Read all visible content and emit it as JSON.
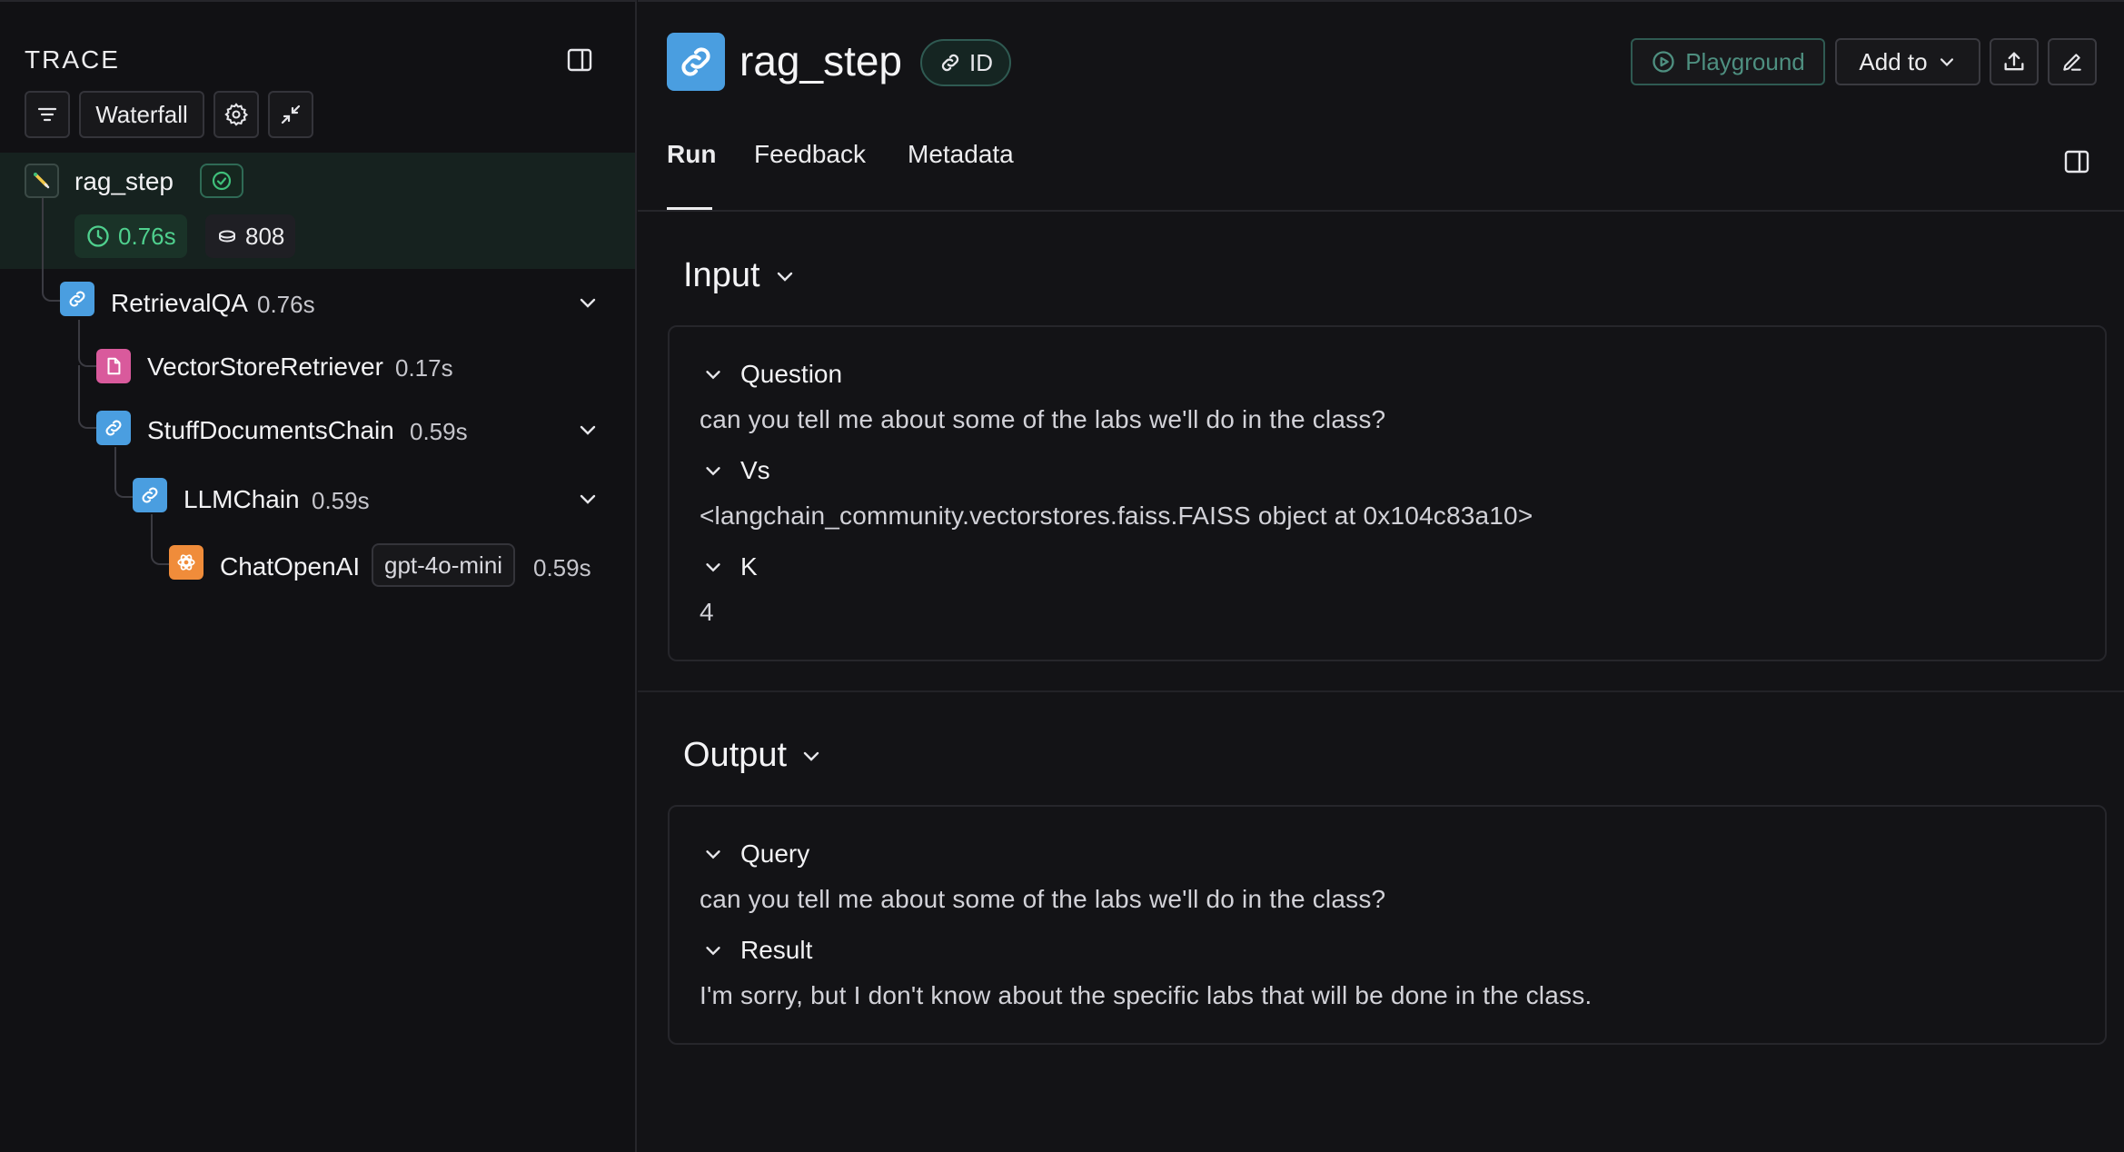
{
  "trace": {
    "title": "TRACE",
    "toolbar": {
      "waterfall_label": "Waterfall"
    },
    "root": {
      "label": "rag_step",
      "latency": "0.76s",
      "tokens": "808",
      "status": "success"
    },
    "nodes": [
      {
        "label": "RetrievalQA",
        "time": "0.76s",
        "icon": "link-icon"
      },
      {
        "label": "VectorStoreRetriever",
        "time": "0.17s",
        "icon": "document-icon"
      },
      {
        "label": "StuffDocumentsChain",
        "time": "0.59s",
        "icon": "link-icon"
      },
      {
        "label": "LLMChain",
        "time": "0.59s",
        "icon": "link-icon"
      },
      {
        "label": "ChatOpenAI",
        "model": "gpt-4o-mini",
        "time": "0.59s",
        "icon": "openai-icon"
      }
    ]
  },
  "header": {
    "title": "rag_step",
    "id_label": "ID",
    "playground_label": "Playground",
    "add_to_label": "Add to"
  },
  "tabs": [
    {
      "label": "Run",
      "active": true
    },
    {
      "label": "Feedback",
      "active": false
    },
    {
      "label": "Metadata",
      "active": false
    }
  ],
  "input": {
    "title": "Input",
    "fields": [
      {
        "key": "Question",
        "value": "can you tell me about some of the labs we'll do in the class?"
      },
      {
        "key": "Vs",
        "value": "<langchain_community.vectorstores.faiss.FAISS object at 0x104c83a10>"
      },
      {
        "key": "K",
        "value": "4"
      }
    ]
  },
  "output": {
    "title": "Output",
    "fields": [
      {
        "key": "Query",
        "value": "can you tell me about some of the labs we'll do in the class?"
      },
      {
        "key": "Result",
        "value": "I'm sorry, but I don't know about the specific labs that will be done in the class."
      }
    ]
  },
  "colors": {
    "chain_icon": "#4a9ee0",
    "retriever_icon": "#d95a9c",
    "llm_icon": "#f08c3a",
    "success": "#3fbf7a"
  }
}
